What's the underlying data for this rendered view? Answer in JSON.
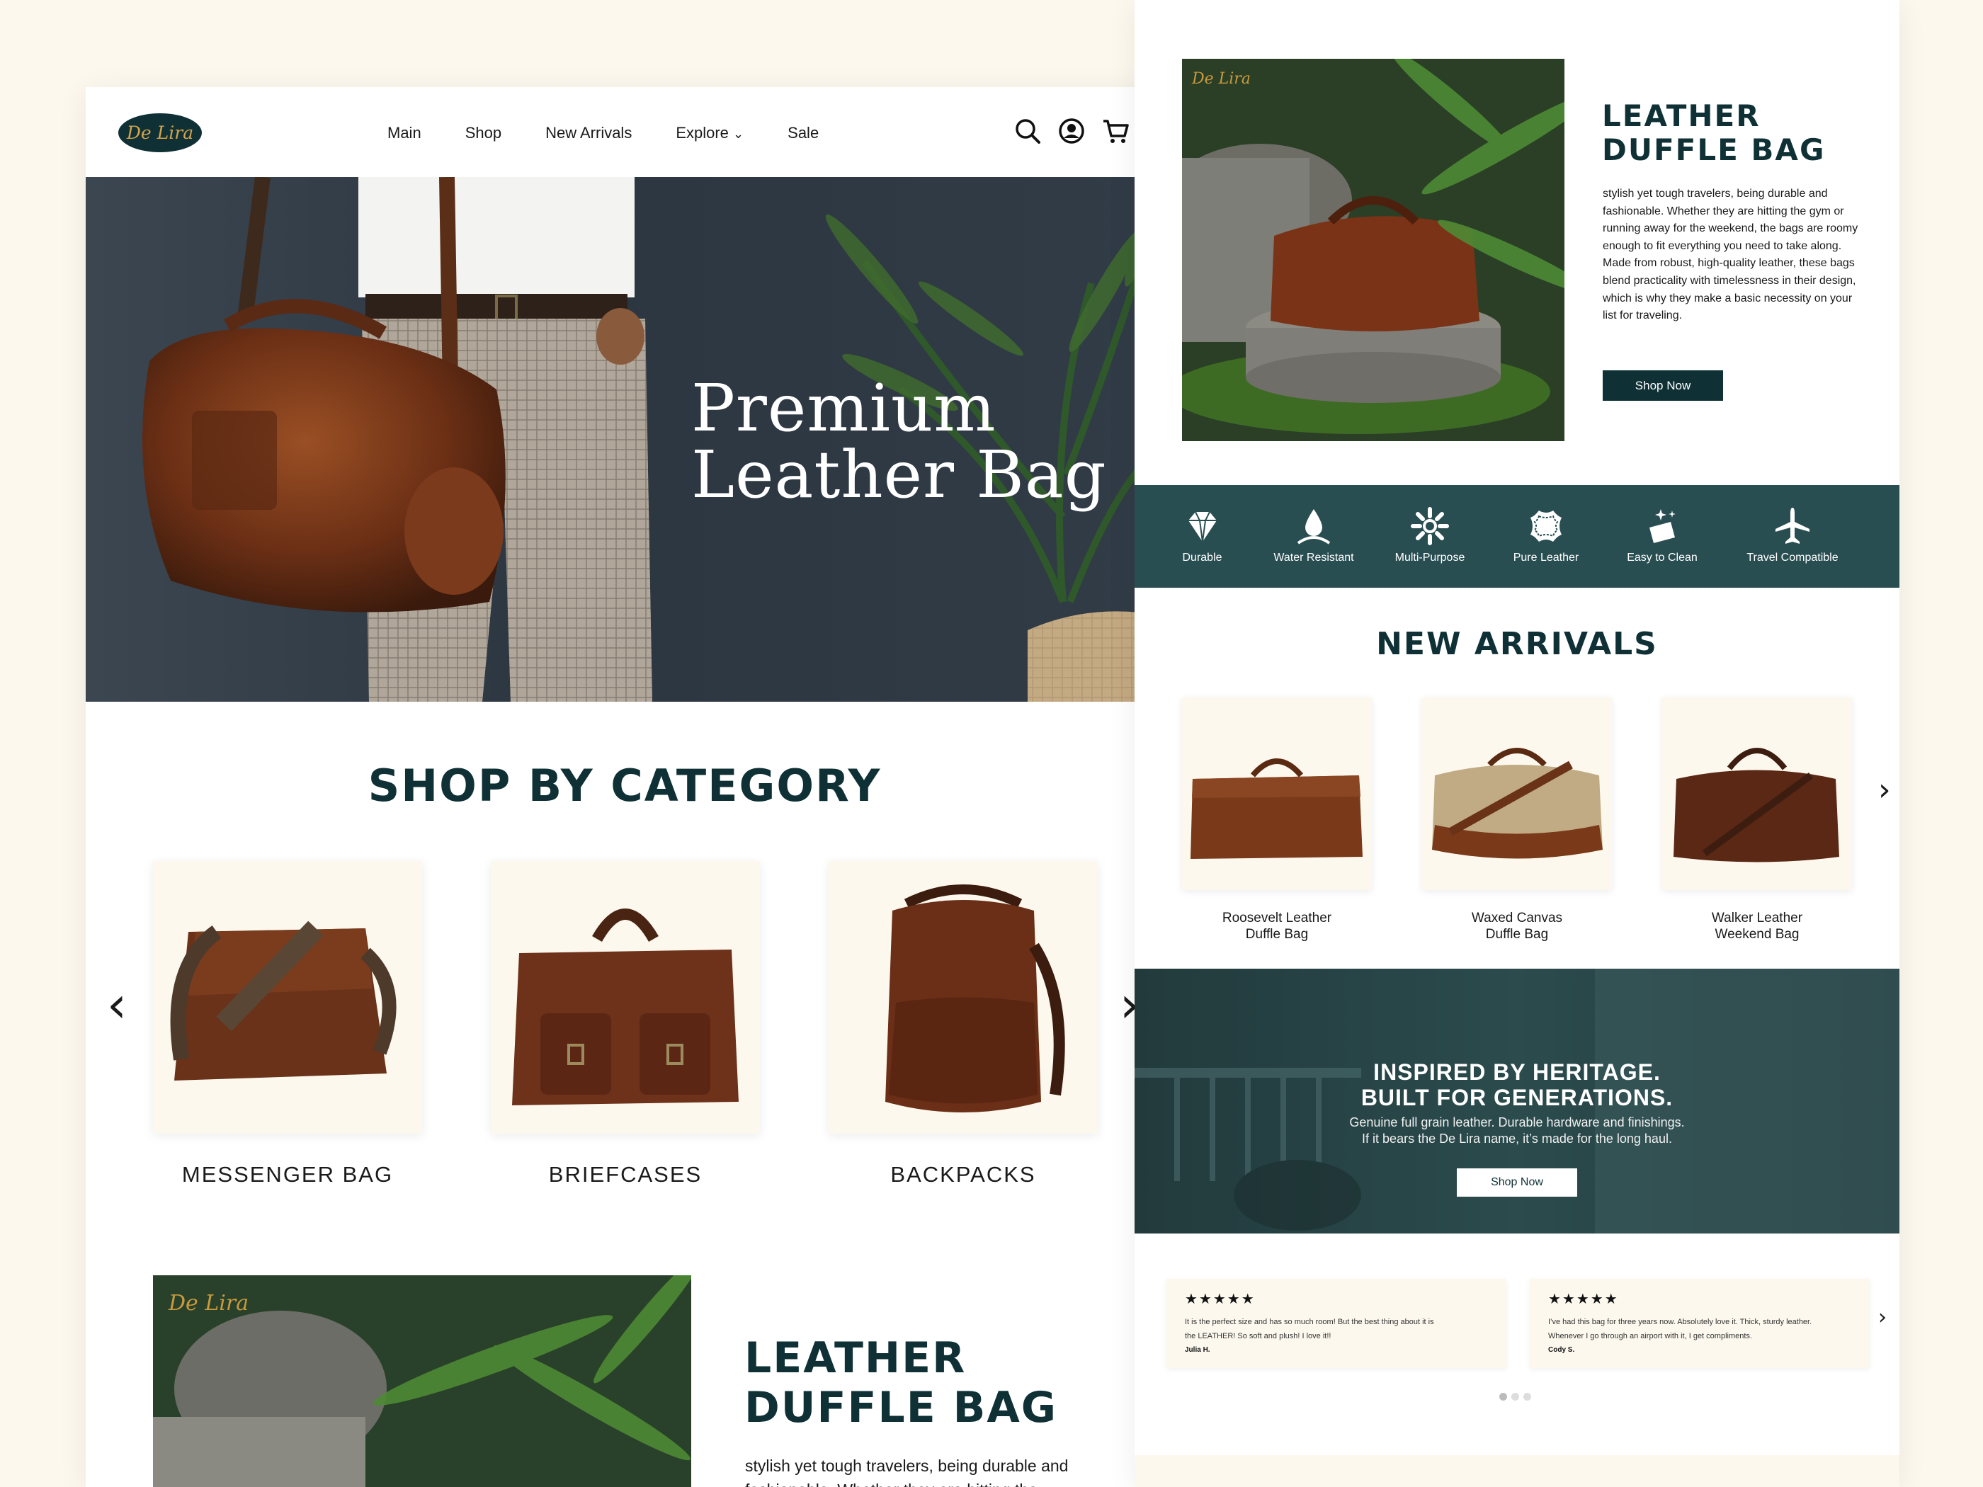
{
  "brand": {
    "logo_text": "De Lira"
  },
  "nav": {
    "items": [
      "Main",
      "Shop",
      "New Arrivals",
      "Explore",
      "Sale"
    ],
    "explore_caret": "⌄"
  },
  "hero": {
    "title_line1": "Premium",
    "title_line2": "Leather Bag"
  },
  "shop_by_category": {
    "title": "SHOP BY CATEGORY",
    "categories": [
      "MESSENGER BAG",
      "BRIEFCASES",
      "BACKPACKS"
    ],
    "prev": "‹",
    "next": "›"
  },
  "duffle": {
    "title_line1": "LEATHER",
    "title_line2": "DUFFLE BAG",
    "body": "stylish yet tough travelers, being durable and fashionable. Whether they are hitting the gym or running away for the weekend, the bags are roomy enough to fit everything you need to take along. Made from robust, high-quality leather, these bags blend practicality with timelessness in their design, which is why they make a basic necessity on your list for traveling.",
    "button": "Shop Now",
    "image_watermark": "De Lira",
    "bottom_preview_line": "stylish yet tough travelers, being durable and",
    "bottom_preview_line2": "fashionable. Whether they are hitting the"
  },
  "features": [
    {
      "icon": "diamond-icon",
      "label": "Durable"
    },
    {
      "icon": "water-drop-icon",
      "label": "Water Resistant"
    },
    {
      "icon": "multi-purpose-icon",
      "label": "Multi-Purpose"
    },
    {
      "icon": "leather-hide-icon",
      "label": "Pure Leather"
    },
    {
      "icon": "easy-clean-icon",
      "label": "Easy to Clean"
    },
    {
      "icon": "airplane-icon",
      "label": "Travel Compatible"
    }
  ],
  "new_arrivals": {
    "title": "NEW ARRIVALS",
    "products": [
      {
        "name_line1": "Roosevelt Leather",
        "name_line2": "Duffle Bag"
      },
      {
        "name_line1": "Waxed Canvas",
        "name_line2": "Duffle Bag"
      },
      {
        "name_line1": "Walker Leather",
        "name_line2": "Weekend Bag"
      }
    ],
    "next": "›"
  },
  "heritage": {
    "title_line1": "INSPIRED BY HERITAGE.",
    "title_line2": "BUILT FOR GENERATIONS.",
    "body_line1": "Genuine full grain leather. Durable hardware and finishings.",
    "body_line2": "If it bears the De Lira name, it’s made for the long haul.",
    "button": "Shop Now"
  },
  "reviews": {
    "items": [
      {
        "stars": "★★★★★",
        "text_line1": "It is the perfect size and has so much room! But the best thing about it is",
        "text_line2": "the LEATHER! So soft and plush! I love it!!",
        "author": "Julia H."
      },
      {
        "stars": "★★★★★",
        "text_line1": "I’ve had this bag for three years now. Absolutely love it. Thick, sturdy leather.",
        "text_line2": "Whenever I go through an airport with it, I get compliments.",
        "author": "Cody S."
      }
    ],
    "next": "›",
    "pagination_total": 3,
    "pagination_active": 1
  },
  "colors": {
    "brand_dark": "#0f3136",
    "accent_gold": "#d4a34a",
    "cream": "#fcf8ee",
    "feature_bar": "#294e52"
  }
}
